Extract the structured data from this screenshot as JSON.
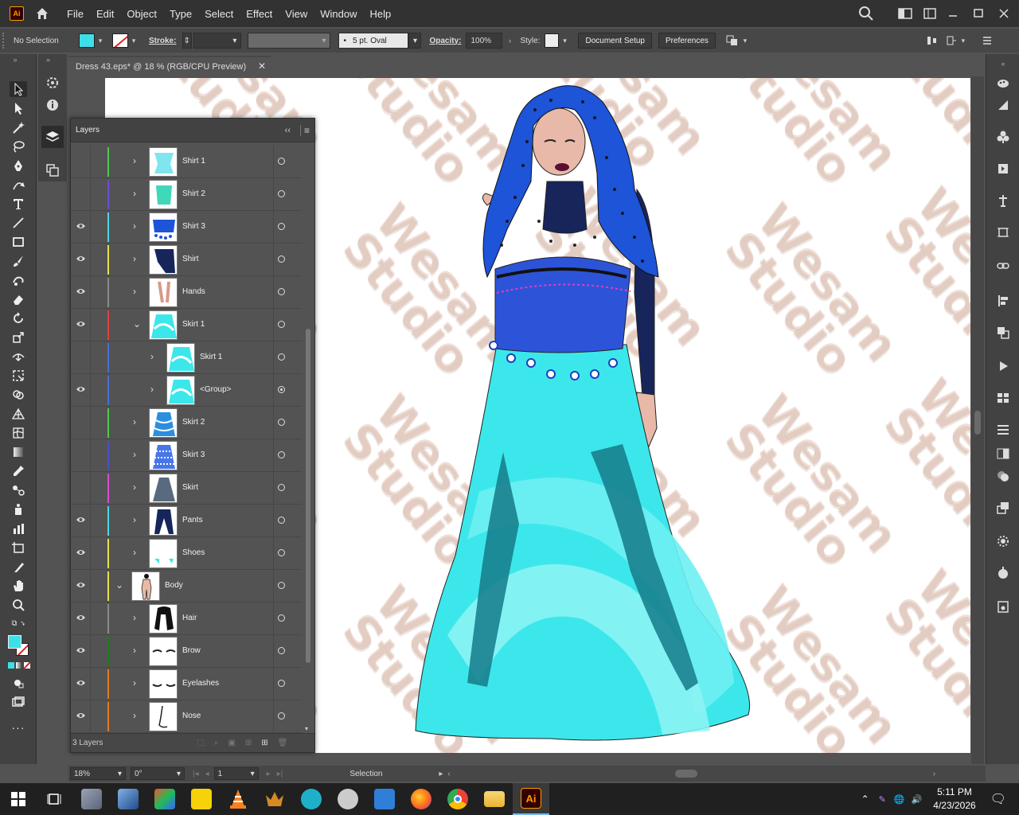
{
  "app": {
    "logo_text": "Ai",
    "menus": [
      "File",
      "Edit",
      "Object",
      "Type",
      "Select",
      "Effect",
      "View",
      "Window",
      "Help"
    ]
  },
  "control_bar": {
    "selection_label": "No Selection",
    "stroke_label": "Stroke:",
    "brush_label": "5 pt. Oval",
    "opacity_label": "Opacity:",
    "opacity_value": "100%",
    "style_label": "Style:",
    "document_setup": "Document Setup",
    "preferences": "Preferences",
    "fill_color": "#3ee0e8"
  },
  "document": {
    "tab_title": "Dress 43.eps* @ 18 % (RGB/CPU Preview)",
    "watermark_text": "Wesam\nStudio"
  },
  "layers_panel": {
    "title": "Layers",
    "footer_count": "3 Layers",
    "rows": [
      {
        "name": "Shirt 1",
        "visible": false,
        "color": "#4ec94e",
        "indent": 0,
        "expanded": false,
        "thumb": "shirt1",
        "target": "open"
      },
      {
        "name": "Shirt 2",
        "visible": false,
        "color": "#6a4fcf",
        "indent": 0,
        "expanded": false,
        "thumb": "shirt2",
        "target": "open"
      },
      {
        "name": "Shirt 3",
        "visible": true,
        "color": "#4fd6e6",
        "indent": 0,
        "expanded": false,
        "thumb": "shirt3",
        "target": "open"
      },
      {
        "name": "Shirt",
        "visible": true,
        "color": "#e6e04f",
        "indent": 0,
        "expanded": false,
        "thumb": "shirt",
        "target": "open"
      },
      {
        "name": "Hands",
        "visible": true,
        "color": "#8a8a8a",
        "indent": 0,
        "expanded": false,
        "thumb": "hands",
        "target": "open"
      },
      {
        "name": "Skirt 1",
        "visible": true,
        "color": "#e04040",
        "indent": 0,
        "expanded": true,
        "thumb": "skirt",
        "target": "open"
      },
      {
        "name": "Skirt 1",
        "visible": false,
        "color": "#4a6fd6",
        "indent": 1,
        "expanded": false,
        "thumb": "skirt",
        "target": "open"
      },
      {
        "name": "<Group>",
        "visible": true,
        "color": "#4a6fd6",
        "indent": 1,
        "expanded": false,
        "thumb": "skirt",
        "target": "filled"
      },
      {
        "name": "Skirt 2",
        "visible": false,
        "color": "#4ec94e",
        "indent": 0,
        "expanded": false,
        "thumb": "skirt2",
        "target": "open"
      },
      {
        "name": "Skirt 3",
        "visible": false,
        "color": "#4a50c8",
        "indent": 0,
        "expanded": false,
        "thumb": "skirt3",
        "target": "open"
      },
      {
        "name": "Skirt",
        "visible": false,
        "color": "#d64fcf",
        "indent": 0,
        "expanded": false,
        "thumb": "skirtg",
        "target": "open"
      },
      {
        "name": "Pants",
        "visible": true,
        "color": "#4fd6e6",
        "indent": 0,
        "expanded": false,
        "thumb": "pants",
        "target": "open"
      },
      {
        "name": "Shoes",
        "visible": true,
        "color": "#e6e04f",
        "indent": 0,
        "expanded": false,
        "thumb": "shoes",
        "target": "open"
      },
      {
        "name": "Body",
        "visible": true,
        "color": "#e6e04f",
        "indent": -1,
        "expanded": true,
        "thumb": "body",
        "target": "open"
      },
      {
        "name": "Hair",
        "visible": true,
        "color": "#8a8a8a",
        "indent": 0,
        "expanded": false,
        "thumb": "hair",
        "target": "open"
      },
      {
        "name": "Brow",
        "visible": true,
        "color": "#1f7a1f",
        "indent": 0,
        "expanded": false,
        "thumb": "brow",
        "target": "open"
      },
      {
        "name": "Eyelashes",
        "visible": true,
        "color": "#e07a1f",
        "indent": 0,
        "expanded": false,
        "thumb": "lash",
        "target": "open"
      },
      {
        "name": "Nose",
        "visible": true,
        "color": "#e07a1f",
        "indent": 0,
        "expanded": false,
        "thumb": "nose",
        "target": "open"
      }
    ]
  },
  "status_bar": {
    "zoom": "18%",
    "rotation": "0°",
    "artboard": "1",
    "tool": "Selection"
  },
  "taskbar": {
    "time": "5:11 PM",
    "date": "4/23/2026"
  }
}
